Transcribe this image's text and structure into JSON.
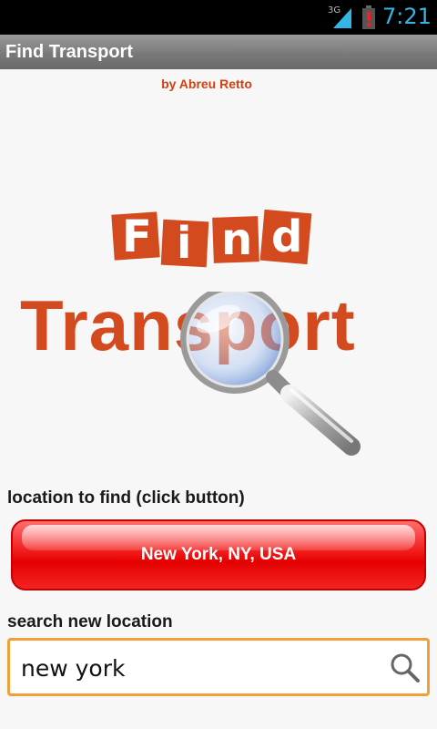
{
  "status_bar": {
    "network": "3G",
    "time": "7:21"
  },
  "app": {
    "title": "Find Transport",
    "byline": "by Abreu Retto"
  },
  "logo": {
    "find_letters": [
      "F",
      "i",
      "n",
      "d"
    ],
    "transport_text": "Transport"
  },
  "location": {
    "label": "location to find (click button)",
    "button_text": "New York, NY, USA"
  },
  "search": {
    "label": "search new location",
    "value": "new york"
  },
  "colors": {
    "brand": "#d34a1e",
    "button_red": "#e50000",
    "focus_orange": "#f0a035",
    "clock_blue": "#33b5e5"
  }
}
